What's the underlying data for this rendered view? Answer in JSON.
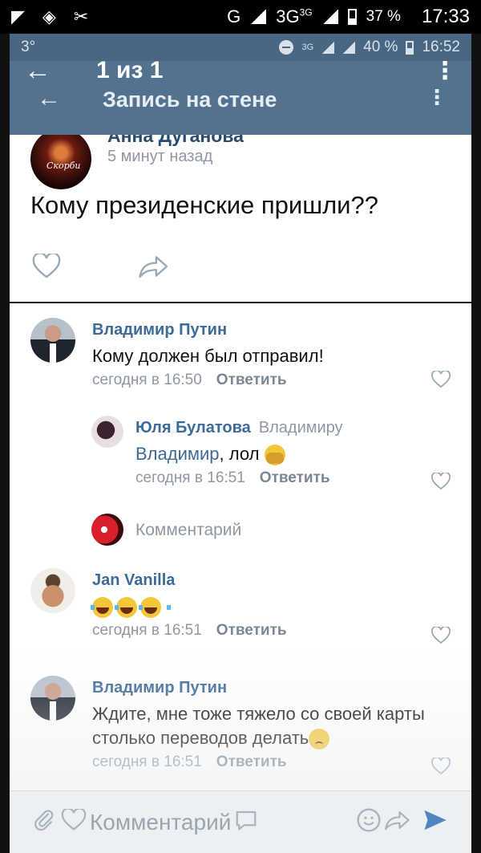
{
  "status_outer": {
    "signal": "G",
    "network": "3G",
    "net_sup": "3G",
    "battery": "37 %",
    "time": "17:33"
  },
  "status_inner": {
    "temp": "3°",
    "net": "3G",
    "battery": "40 %",
    "time": "16:52"
  },
  "gallery": {
    "counter": "1 из 1"
  },
  "header": {
    "title": "Запись на стене"
  },
  "post": {
    "author": "Анна Дуганова",
    "avatar_text": "Скорби",
    "time": "5 минут назад",
    "text": "Кому президенские пришли??"
  },
  "comments": [
    {
      "author": "Владимир Путин",
      "text": "Кому должен был отправил!",
      "time": "сегодня в 16:50",
      "reply": "Ответить"
    },
    {
      "author": "Юля Булатова",
      "reply_to": "Владимиру",
      "mention": "Владимир",
      "text": ", лол",
      "time": "сегодня в 16:51",
      "reply": "Ответить"
    },
    {
      "author": "Jan Vanilla",
      "time": "сегодня в 16:51",
      "reply": "Ответить"
    },
    {
      "author": "Владимир Путин",
      "text": "Ждите, мне тоже тяжело со своей карты столько переводов делать",
      "time": "сегодня в 16:51",
      "reply": "Ответить"
    }
  ],
  "reply_prompt": "Комментарий",
  "compose": {
    "placeholder": "Комментарий"
  },
  "colors": {
    "header": "#53728f",
    "link": "#3d6a99",
    "muted": "#8e98a3"
  }
}
